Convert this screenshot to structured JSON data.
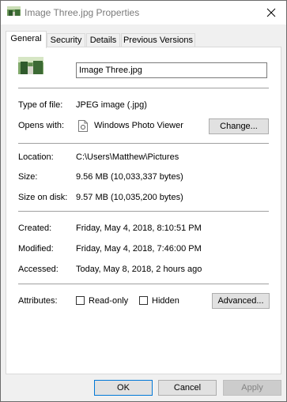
{
  "window": {
    "title": "Image Three.jpg Properties",
    "close_icon": "close-icon"
  },
  "tabs": [
    {
      "label": "General",
      "active": true
    },
    {
      "label": "Security",
      "active": false
    },
    {
      "label": "Details",
      "active": false
    },
    {
      "label": "Previous Versions",
      "active": false
    }
  ],
  "general": {
    "file_name": "Image Three.jpg",
    "type_label": "Type of file:",
    "type_value": "JPEG image (.jpg)",
    "opens_label": "Opens with:",
    "opens_value": "Windows Photo Viewer",
    "change_button": "Change...",
    "location_label": "Location:",
    "location_value": "C:\\Users\\Matthew\\Pictures",
    "size_label": "Size:",
    "size_value": "9.56 MB (10,033,337 bytes)",
    "size_on_disk_label": "Size on disk:",
    "size_on_disk_value": "9.57 MB (10,035,200 bytes)",
    "created_label": "Created:",
    "created_value": "Friday, May 4, 2018, 8:10:51 PM",
    "modified_label": "Modified:",
    "modified_value": "Friday, May 4, 2018, 7:46:00 PM",
    "accessed_label": "Accessed:",
    "accessed_value": "Today, May 8, 2018, 2 hours ago",
    "attributes_label": "Attributes:",
    "readonly_label": "Read-only",
    "readonly_checked": false,
    "hidden_label": "Hidden",
    "hidden_checked": false,
    "advanced_button": "Advanced..."
  },
  "footer": {
    "ok": "OK",
    "cancel": "Cancel",
    "apply": "Apply",
    "apply_enabled": false
  },
  "colors": {
    "accent": "#0078d7",
    "title_text": "#7a7a7a",
    "button_face": "#e1e1e1"
  }
}
